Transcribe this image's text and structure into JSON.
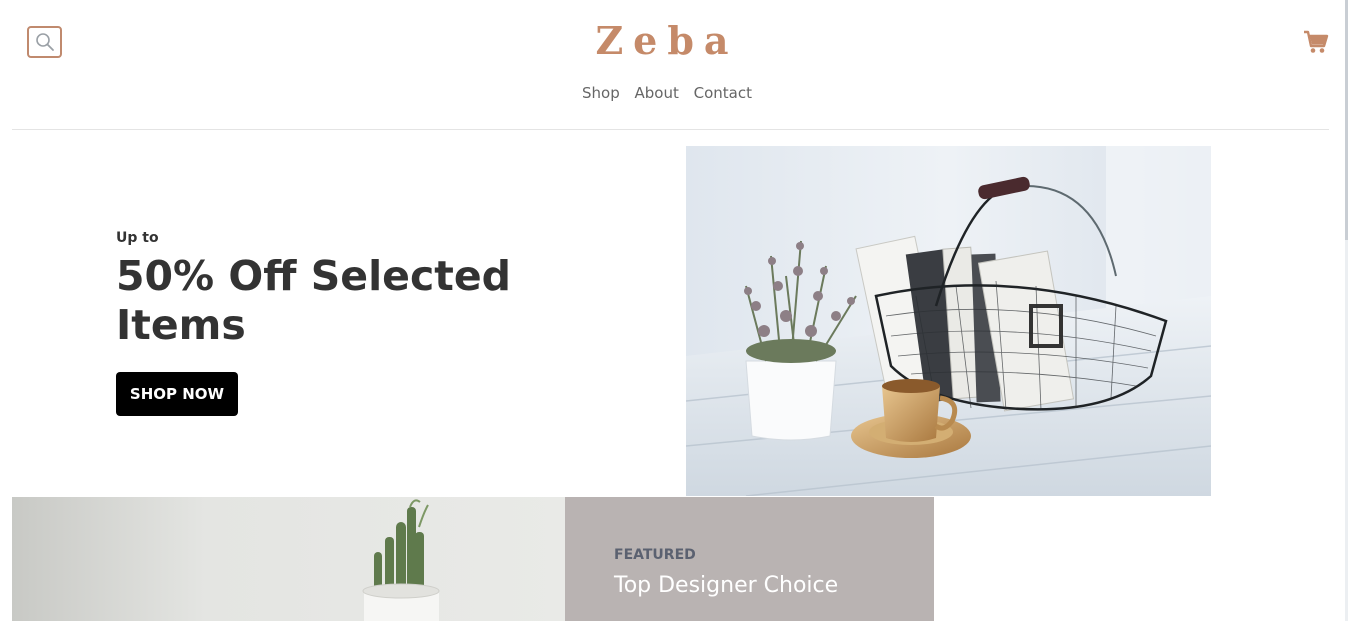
{
  "header": {
    "logo": "Zeba",
    "search_icon": "search-icon",
    "cart_icon": "shopping-cart-icon"
  },
  "nav": {
    "items": [
      {
        "label": "Shop"
      },
      {
        "label": "About"
      },
      {
        "label": "Contact"
      }
    ]
  },
  "hero": {
    "kicker": "Up to",
    "title": "50% Off Selected Items",
    "button_label": "SHOP NOW",
    "image": "basket-books-plant-cup-photo"
  },
  "featured": {
    "kicker": "FEATURED",
    "title": "Top Designer Choice",
    "image": "cactus-pot-photo"
  },
  "colors": {
    "brand": "#c58a69",
    "button": "#000000",
    "featured_panel": "#b9b3b2",
    "text_dark": "#333333"
  }
}
